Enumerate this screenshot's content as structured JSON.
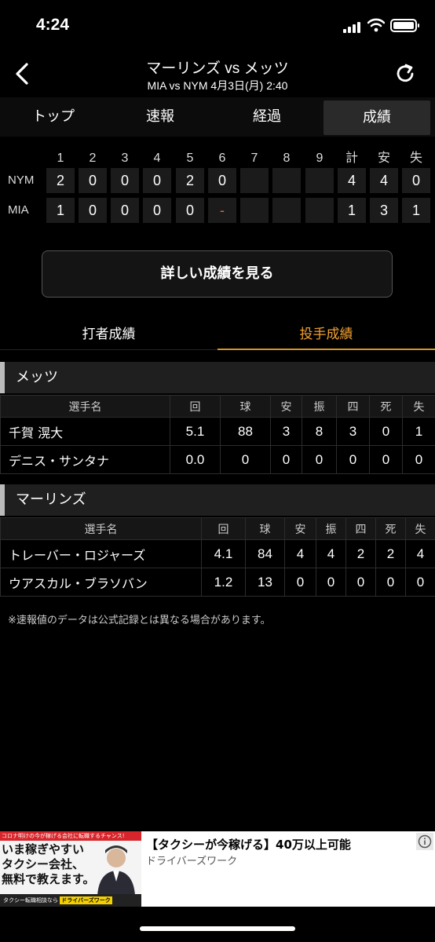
{
  "status": {
    "time": "4:24"
  },
  "header": {
    "title": "マーリンズ vs メッツ",
    "subtitle": "MIA vs NYM 4月3日(月) 2:40"
  },
  "tabs": [
    {
      "label": "トップ"
    },
    {
      "label": "速報"
    },
    {
      "label": "経過"
    },
    {
      "label": "成績"
    }
  ],
  "scoreboard": {
    "innings": [
      "1",
      "2",
      "3",
      "4",
      "5",
      "6",
      "7",
      "8",
      "9"
    ],
    "totals_labels": [
      "計",
      "安",
      "失"
    ],
    "rows": [
      {
        "team": "NYM",
        "innings": [
          "2",
          "0",
          "0",
          "0",
          "2",
          "0",
          "",
          "",
          ""
        ],
        "totals": [
          "4",
          "4",
          "0"
        ]
      },
      {
        "team": "MIA",
        "innings": [
          "1",
          "0",
          "0",
          "0",
          "0",
          "-",
          "",
          "",
          ""
        ],
        "totals": [
          "1",
          "3",
          "1"
        ]
      }
    ]
  },
  "detail_button": "詳しい成績を見る",
  "stat_tabs": {
    "batting": "打者成績",
    "pitching": "投手成績"
  },
  "pitching_headers": [
    "選手名",
    "回",
    "球",
    "安",
    "振",
    "四",
    "死",
    "失"
  ],
  "teams": [
    {
      "name": "メッツ",
      "players": [
        {
          "name": "千賀 滉大",
          "stats": [
            "5.1",
            "88",
            "3",
            "8",
            "3",
            "0",
            "1"
          ]
        },
        {
          "name": "デニス・サンタナ",
          "stats": [
            "0.0",
            "0",
            "0",
            "0",
            "0",
            "0",
            "0"
          ]
        }
      ]
    },
    {
      "name": "マーリンズ",
      "players": [
        {
          "name": "トレーバー・ロジャーズ",
          "stats": [
            "4.1",
            "84",
            "4",
            "4",
            "2",
            "2",
            "4"
          ]
        },
        {
          "name": "ウアスカル・ブラソバン",
          "stats": [
            "1.2",
            "13",
            "0",
            "0",
            "0",
            "0",
            "0"
          ]
        }
      ]
    }
  ],
  "note": "※速報値のデータは公式記録とは異なる場合があります。",
  "ad": {
    "image_top": "コロナ明けの今が稼げる会社に転職するチャンス!",
    "image_headline": "いま稼ぎやすい タクシー会社、 無料で教えます。",
    "image_bottom": "タクシー転職相談なら",
    "image_brand": "ドライバーズワーク",
    "title": "【タクシーが今稼げる】40万以上可能",
    "source": "ドライバーズワーク"
  },
  "colors": {
    "accent": "#f0a030",
    "dash": "#e8633a",
    "cell_bg": "#1b1b1b"
  },
  "icons": {
    "back": "chevron-left-icon",
    "refresh": "refresh-icon",
    "ad_info": "info-icon"
  }
}
